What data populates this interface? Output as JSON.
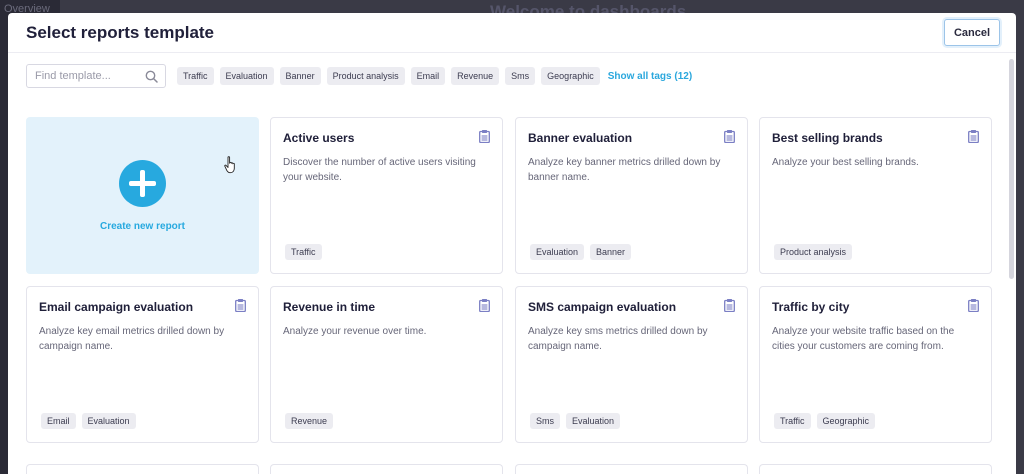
{
  "background": {
    "sidebar_text": "Overview",
    "page_title": "Welcome to dashboards"
  },
  "modal": {
    "title": "Select reports template",
    "cancel_label": "Cancel"
  },
  "search": {
    "placeholder": "Find template...",
    "icon": "search-icon"
  },
  "filter_tags": [
    "Traffic",
    "Evaluation",
    "Banner",
    "Product analysis",
    "Email",
    "Revenue",
    "Sms",
    "Geographic"
  ],
  "show_all_label": "Show all tags (12)",
  "create_card": {
    "label": "Create new report",
    "icon": "plus-icon"
  },
  "templates": [
    {
      "title": "Active users",
      "description": "Discover the number of active users visiting your website.",
      "tags": [
        "Traffic"
      ]
    },
    {
      "title": "Banner evaluation",
      "description": "Analyze key banner metrics drilled down by banner name.",
      "tags": [
        "Evaluation",
        "Banner"
      ]
    },
    {
      "title": "Best selling brands",
      "description": "Analyze your best selling brands.",
      "tags": [
        "Product analysis"
      ]
    },
    {
      "title": "Email campaign evaluation",
      "description": "Analyze key email metrics drilled down by campaign name.",
      "tags": [
        "Email",
        "Evaluation"
      ]
    },
    {
      "title": "Revenue in time",
      "description": "Analyze your revenue over time.",
      "tags": [
        "Revenue"
      ]
    },
    {
      "title": "SMS campaign evaluation",
      "description": "Analyze key sms metrics drilled down by campaign name.",
      "tags": [
        "Sms",
        "Evaluation"
      ]
    },
    {
      "title": "Traffic by city",
      "description": "Analyze your website traffic based on the cities your customers are coming from.",
      "tags": [
        "Traffic",
        "Geographic"
      ]
    }
  ],
  "colors": {
    "accent": "#27a9df",
    "create_card_bg": "#e3f2fb",
    "clipboard_icon": "#7b7fc4",
    "tag_bg": "#ececf1"
  }
}
